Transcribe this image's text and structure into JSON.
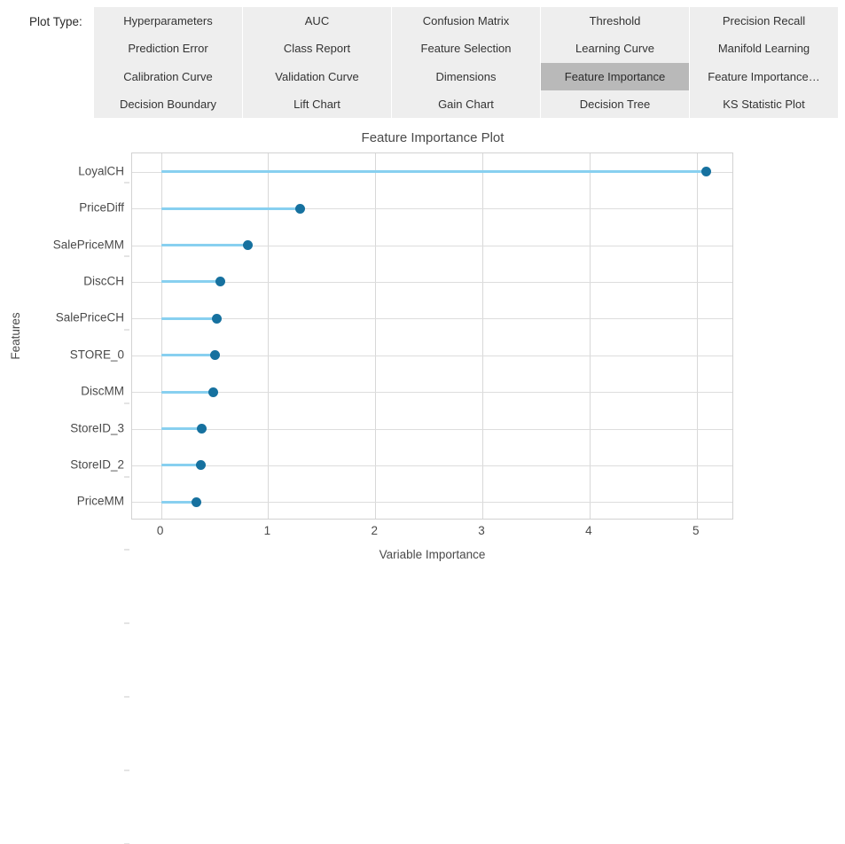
{
  "toolbar": {
    "label": "Plot Type:",
    "selected": "Feature Importance",
    "columns": [
      {
        "items": [
          "Hyperparameters",
          "Prediction Error",
          "Calibration Curve",
          "Decision Boundary"
        ]
      },
      {
        "items": [
          "AUC",
          "Class Report",
          "Validation Curve",
          "Lift Chart"
        ]
      },
      {
        "items": [
          "Confusion Matrix",
          "Feature Selection",
          "Dimensions",
          "Gain Chart"
        ]
      },
      {
        "items": [
          "Threshold",
          "Learning Curve",
          "Feature Importance",
          "Decision Tree"
        ]
      },
      {
        "items": [
          "Precision Recall",
          "Manifold Learning",
          "Feature Importance…",
          "KS Statistic Plot"
        ]
      }
    ]
  },
  "colors": {
    "panel_bg": "#eeeeee",
    "selected_bg": "#b9b9b9",
    "stem": "#88d0f0",
    "dot": "#16719f",
    "grid": "#d8d8d8",
    "text": "#4a4a4a"
  },
  "chart_data": {
    "type": "bar",
    "title": "Feature Importance Plot",
    "xlabel": "Variable Importance",
    "ylabel": "Features",
    "categories": [
      "LoyalCH",
      "PriceDiff",
      "SalePriceMM",
      "DiscCH",
      "SalePriceCH",
      "STORE_0",
      "DiscMM",
      "StoreID_3",
      "StoreID_2",
      "PriceMM"
    ],
    "values": [
      5.09,
      1.3,
      0.81,
      0.55,
      0.52,
      0.5,
      0.49,
      0.38,
      0.37,
      0.33
    ],
    "xlim": [
      -0.27,
      5.35
    ],
    "xticks": [
      "0",
      "1",
      "2",
      "3",
      "4",
      "5"
    ],
    "xtick_values": [
      0,
      1,
      2,
      3,
      4,
      5
    ],
    "grid": true,
    "legend": "none"
  }
}
